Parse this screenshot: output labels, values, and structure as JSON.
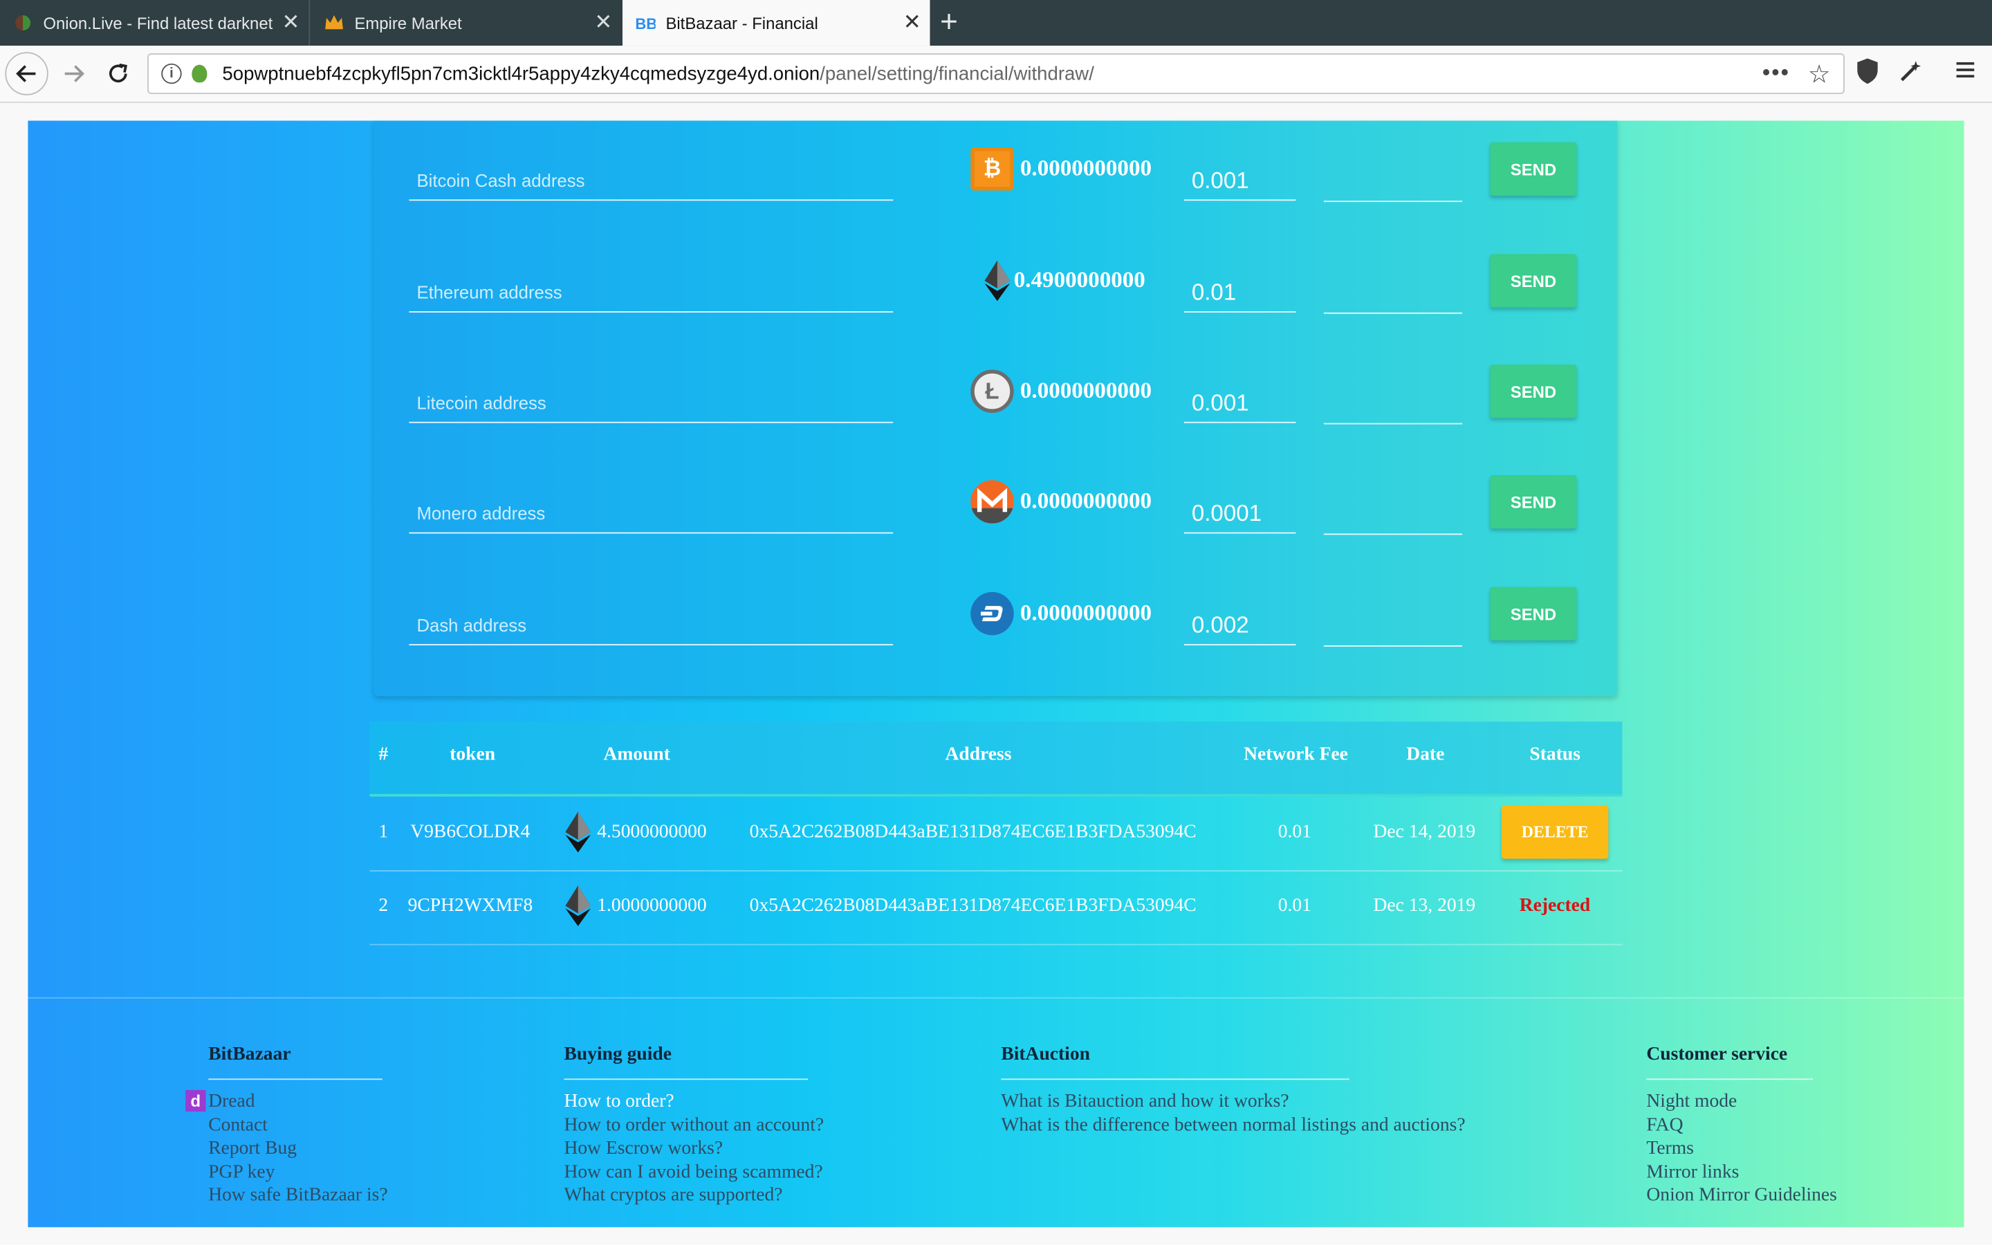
{
  "browser": {
    "tabs": [
      {
        "title": "Onion.Live - Find latest darknet",
        "active": false
      },
      {
        "title": "Empire Market",
        "active": false
      },
      {
        "title": "BitBazaar - Financial",
        "active": true
      }
    ],
    "url_host": "5opwptnuebf4zcpkyfl5pn7cm3icktl4r5appy4zky4cqmedsyzge4yd.onion",
    "url_path": "/panel/setting/financial/withdraw/"
  },
  "withdraw": {
    "send_label": "SEND",
    "rows": [
      {
        "placeholder": "Bitcoin Cash address",
        "coin": "bitcoin-cash-icon",
        "balance": "0.0000000000",
        "amount": "0.001"
      },
      {
        "placeholder": "Ethereum address",
        "coin": "ethereum-icon",
        "balance": "0.4900000000",
        "amount": "0.01"
      },
      {
        "placeholder": "Litecoin address",
        "coin": "litecoin-icon",
        "balance": "0.0000000000",
        "amount": "0.001"
      },
      {
        "placeholder": "Monero address",
        "coin": "monero-icon",
        "balance": "0.0000000000",
        "amount": "0.0001"
      },
      {
        "placeholder": "Dash address",
        "coin": "dash-icon",
        "balance": "0.0000000000",
        "amount": "0.002"
      }
    ]
  },
  "table": {
    "headers": [
      "#",
      "token",
      "Amount",
      "Address",
      "Network Fee",
      "Date",
      "Status"
    ],
    "rows": [
      {
        "num": "1",
        "token": "V9B6COLDR4",
        "amount": "4.5000000000",
        "address": "0x5A2C262B08D443aBE131D874EC6E1B3FDA53094C",
        "fee": "0.01",
        "date": "Dec 14, 2019",
        "status": "DELETE"
      },
      {
        "num": "2",
        "token": "9CPH2WXMF8",
        "amount": "1.0000000000",
        "address": "0x5A2C262B08D443aBE131D874EC6E1B3FDA53094C",
        "fee": "0.01",
        "date": "Dec 13, 2019",
        "status": "Rejected"
      }
    ]
  },
  "footer": {
    "bitbazaar": {
      "title": "BitBazaar",
      "links": [
        "Dread",
        "Contact",
        "Report Bug",
        "PGP key",
        "How safe BitBazaar is?"
      ]
    },
    "buying": {
      "title": "Buying guide",
      "links": [
        "How to order?",
        "How to order without an account?",
        "How Escrow works?",
        "How can I avoid being scammed?",
        "What cryptos are supported?"
      ]
    },
    "bitauction": {
      "title": "BitAuction",
      "links": [
        "What is Bitauction and how it works?",
        "What is the difference between normal listings and auctions?"
      ]
    },
    "customer": {
      "title": "Customer service",
      "links": [
        "Night mode",
        "FAQ",
        "Terms",
        "Mirror links",
        "Onion Mirror Guidelines"
      ]
    }
  },
  "colors": {
    "send": "#3acd8b",
    "delete": "#fbbb14",
    "rejected": "#e01010",
    "dread": "#9d3bd1"
  }
}
